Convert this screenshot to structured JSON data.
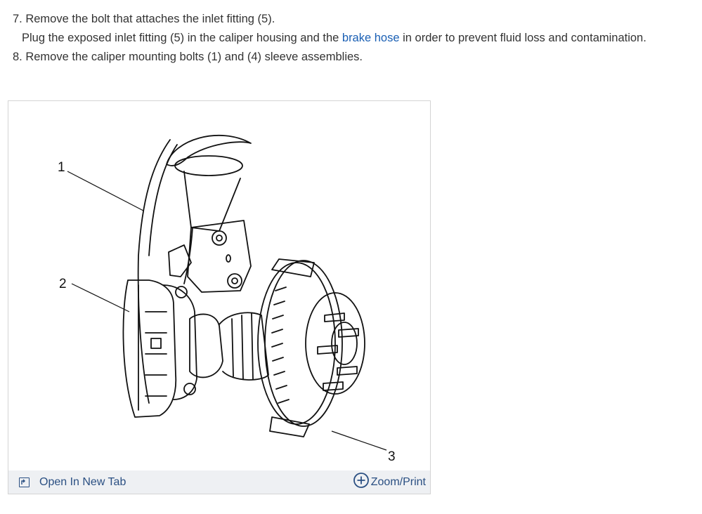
{
  "steps": {
    "step7_line1": "7. Remove the bolt that attaches the inlet fitting (5).",
    "step7_line2_before": "Plug the exposed inlet fitting (5) in the caliper housing and the ",
    "step7_line2_link": "brake hose",
    "step7_line2_after": " in order to prevent fluid loss and contamination.",
    "step8": "8. Remove the caliper mounting bolts (1) and (4) sleeve assemblies."
  },
  "figure": {
    "callouts": [
      "1",
      "2",
      "3"
    ],
    "open_new_tab_label": "Open In New Tab",
    "zoom_print_label": "Zoom/Print",
    "icons": {
      "open_new_tab": "open-new-tab-icon",
      "zoom": "zoom-plus-icon"
    }
  },
  "colors": {
    "text": "#333333",
    "link": "#1a5fb4",
    "bar_background": "#eef0f3",
    "bar_text": "#2a4f82"
  }
}
